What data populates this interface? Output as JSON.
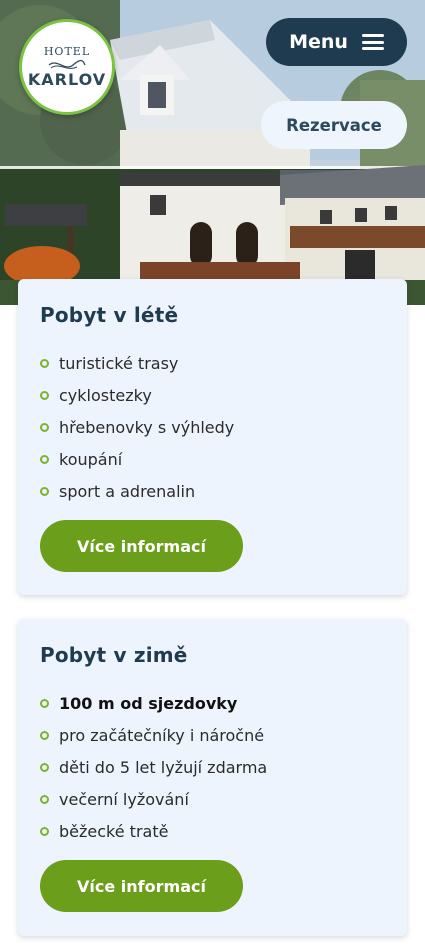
{
  "header": {
    "logo": {
      "top": "HOTEL",
      "bottom": "KARLOV"
    },
    "menu_label": "Menu",
    "reservation_label": "Rezervace"
  },
  "cards": [
    {
      "title": "Pobyt v létě",
      "items": [
        "turistické trasy",
        "cyklostezky",
        "hřebenovky s výhledy",
        "koupání",
        "sport a adrenalin"
      ],
      "button": "Více informací"
    },
    {
      "title": "Pobyt v zimě",
      "items": [
        "100 m od sjezdovky",
        "pro začátečníky i náročné",
        "děti do 5 let lyžují zdarma",
        "večerní lyžování",
        "běžecké tratě"
      ],
      "button": "Více informací"
    }
  ],
  "colors": {
    "menu_bg": "#1f3b4f",
    "reservation_bg": "#eef5fd",
    "card_bg": "#edf4fd",
    "accent_green": "#6b9e1a",
    "logo_ring": "#7cc243"
  }
}
